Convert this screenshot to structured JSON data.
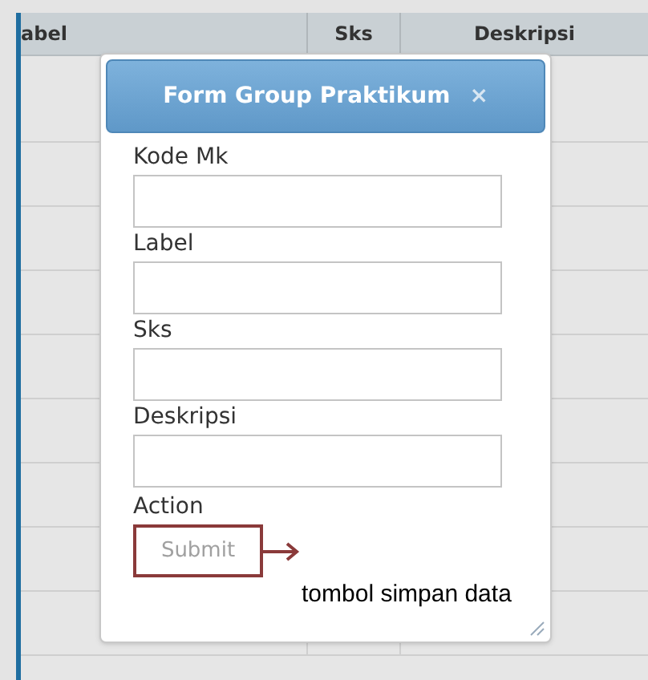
{
  "table": {
    "columns": [
      "abel",
      "Sks",
      "Deskripsi"
    ]
  },
  "dialog": {
    "title": "Form Group Praktikum",
    "close": "×",
    "fields": [
      {
        "label": "Kode Mk"
      },
      {
        "label": "Label"
      },
      {
        "label": "Sks"
      },
      {
        "label": "Deskripsi"
      }
    ],
    "action_label": "Action",
    "submit": "Submit"
  },
  "annotation": "tombol simpan data"
}
